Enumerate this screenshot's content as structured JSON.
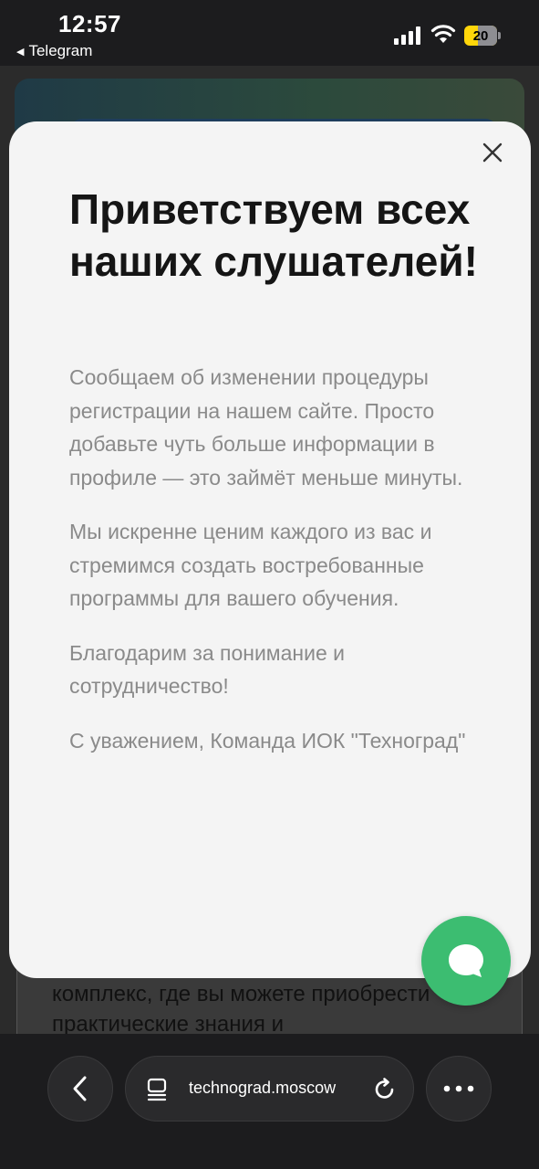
{
  "status_bar": {
    "time": "12:57",
    "back_app_label": "Telegram",
    "battery_level": "20"
  },
  "background_page": {
    "card_text": "комплекс, где вы можете приобрести практические знания и"
  },
  "modal": {
    "title": "Приветствуем всех наших слушателей!",
    "paragraphs": [
      "Сообщаем об изменении процедуры регистрации на нашем сайте. Просто добавьте чуть больше информации в профиле — это займёт меньше минуты.",
      "Мы искренне ценим каждого из вас и стремимся создать востребованные программы для вашего обучения.",
      "Благодарим за понимание и сотрудничество!",
      "С уважением, Команда ИОК \"Техноград\""
    ],
    "close_icon": "close-icon"
  },
  "chat_button": {
    "icon": "chat-bubble-icon",
    "color": "#3cbd71"
  },
  "browser_bar": {
    "url": "technograd.moscow",
    "back_icon": "chevron-left-icon",
    "tabs_icon": "tabs-icon",
    "reload_icon": "reload-icon",
    "more_icon": "more-dots-icon"
  }
}
